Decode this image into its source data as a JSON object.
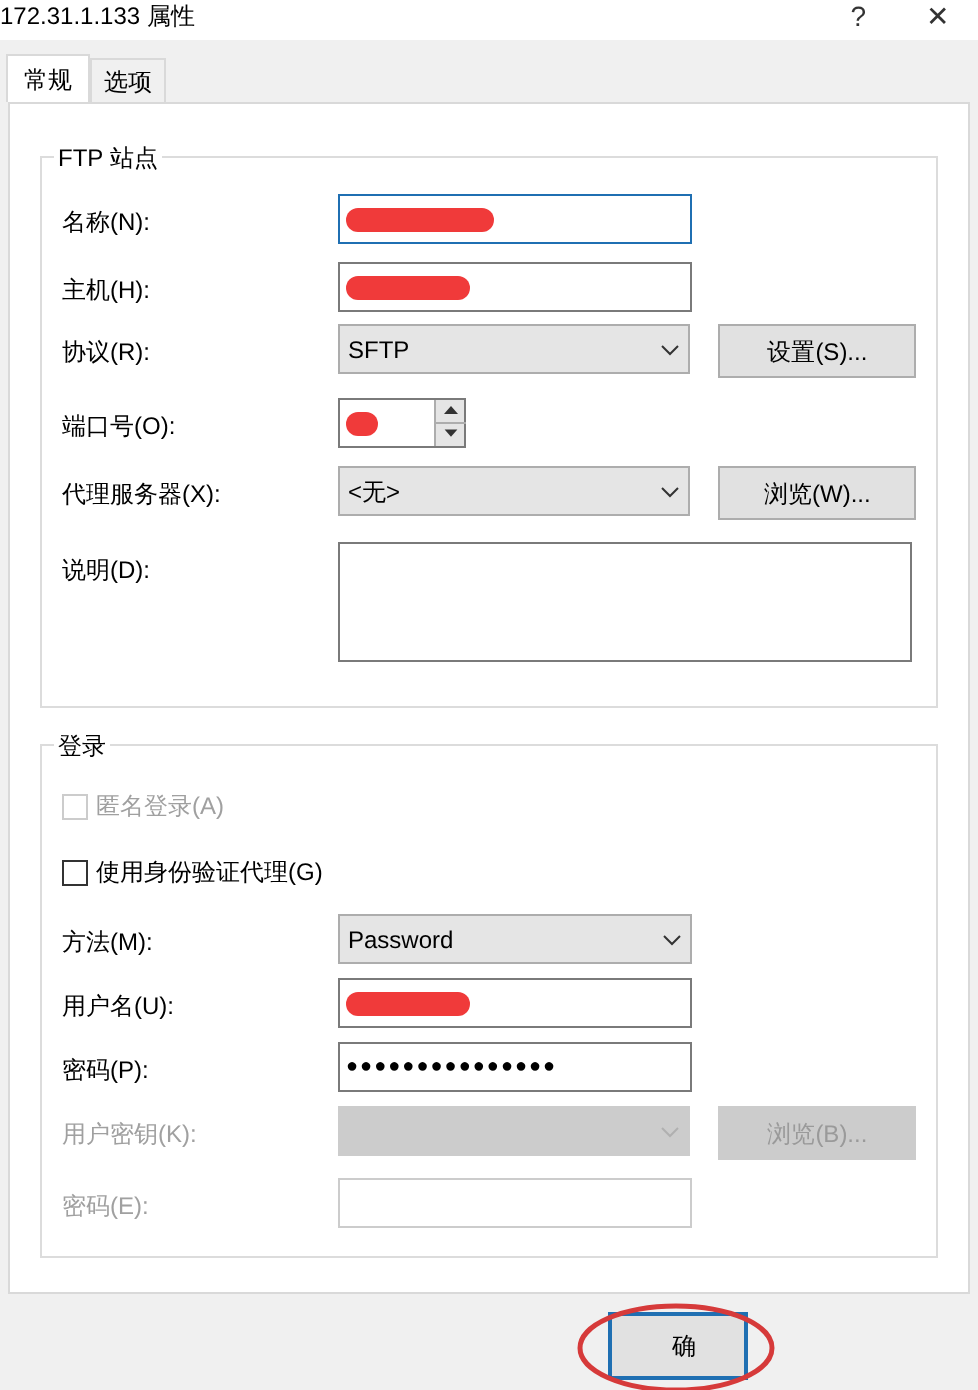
{
  "window": {
    "title": "172.31.1.133 属性",
    "help": "?",
    "close": "✕"
  },
  "tabs": [
    {
      "label": "常规",
      "selected": true
    },
    {
      "label": "选项",
      "selected": false
    }
  ],
  "site_group": {
    "title": "FTP 站点",
    "rows": [
      {
        "kind": "text",
        "label": "名称(N):",
        "focused": true,
        "redacted": true
      },
      {
        "kind": "text",
        "label": "主机(H):",
        "focused": false,
        "redacted": true
      },
      {
        "kind": "select",
        "label": "协议(R):",
        "value": "SFTP",
        "button": "设置(S)..."
      },
      {
        "kind": "spin",
        "label": "端口号(O):",
        "redacted": true
      },
      {
        "kind": "select",
        "label": "代理服务器(X):",
        "value": "<无>",
        "button": "浏览(W)..."
      },
      {
        "kind": "memo",
        "label": "说明(D):"
      }
    ]
  },
  "login_group": {
    "title": "登录",
    "rows": [
      {
        "kind": "check",
        "label": "匿名登录(A)",
        "checked": false,
        "disabled": true
      },
      {
        "kind": "check",
        "label": "使用身份验证代理(G)",
        "checked": false,
        "disabled": false
      },
      {
        "kind": "select",
        "label": "方法(M):",
        "value": "Password",
        "disabled": false
      },
      {
        "kind": "text",
        "label": "用户名(U):",
        "redacted": true,
        "disabled": false
      },
      {
        "kind": "text",
        "label": "密码(P):",
        "value": "●●●●●●●●●●●●●●●",
        "disabled": false
      },
      {
        "kind": "select",
        "label": "用户密钥(K):",
        "disabled": true,
        "button": "浏览(B)..."
      },
      {
        "kind": "text",
        "label": "密码(E):",
        "disabled": true
      }
    ]
  },
  "ok_button": {
    "label": "确",
    "highlighted": true
  }
}
